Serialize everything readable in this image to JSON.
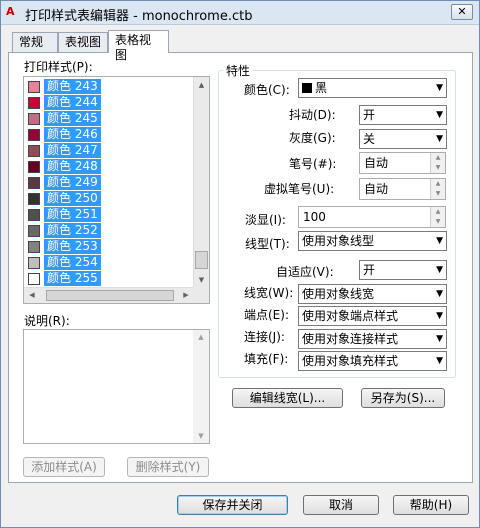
{
  "window": {
    "title": "打印样式表编辑器 - monochrome.ctb",
    "close": "✕",
    "app_icon": "A"
  },
  "tabs": [
    "常规",
    "表视图",
    "表格视图"
  ],
  "styles_label": "打印样式(P):",
  "styles": [
    {
      "name": "颜色 243",
      "color": "#e6839a"
    },
    {
      "name": "颜色 244",
      "color": "#cc0033"
    },
    {
      "name": "颜色 245",
      "color": "#c06f80"
    },
    {
      "name": "颜色 246",
      "color": "#990033"
    },
    {
      "name": "颜色 247",
      "color": "#8c4d5c"
    },
    {
      "name": "颜色 248",
      "color": "#660022"
    },
    {
      "name": "颜色 249",
      "color": "#5c3a44"
    },
    {
      "name": "颜色 250",
      "color": "#333333"
    },
    {
      "name": "颜色 251",
      "color": "#505050"
    },
    {
      "name": "颜色 252",
      "color": "#696969"
    },
    {
      "name": "颜色 253",
      "color": "#828282"
    },
    {
      "name": "颜色 254",
      "color": "#bebebe"
    },
    {
      "name": "颜色 255",
      "color": "#ffffff"
    }
  ],
  "description_label": "说明(R):",
  "add_style": "添加样式(A)",
  "delete_style": "删除样式(Y)",
  "props": {
    "group_title": "特性",
    "color_label": "颜色(C):",
    "color_value": "黑",
    "dither_label": "抖动(D):",
    "dither_value": "开",
    "grayscale_label": "灰度(G):",
    "grayscale_value": "关",
    "pen_label": "笔号(#):",
    "pen_value": "自动",
    "vpen_label": "虚拟笔号(U):",
    "vpen_value": "自动",
    "screening_label": "淡显(I):",
    "screening_value": "100",
    "linetype_label": "线型(T):",
    "linetype_value": "使用对象线型",
    "adaptive_label": "自适应(V):",
    "adaptive_value": "开",
    "lineweight_label": "线宽(W):",
    "lineweight_value": "使用对象线宽",
    "endstyle_label": "端点(E):",
    "endstyle_value": "使用对象端点样式",
    "joinstyle_label": "连接(J):",
    "joinstyle_value": "使用对象连接样式",
    "fillstyle_label": "填充(F):",
    "fillstyle_value": "使用对象填充样式"
  },
  "edit_lineweights": "编辑线宽(L)...",
  "save_as": "另存为(S)...",
  "save_close": "保存并关闭",
  "cancel": "取消",
  "help": "帮助(H)"
}
